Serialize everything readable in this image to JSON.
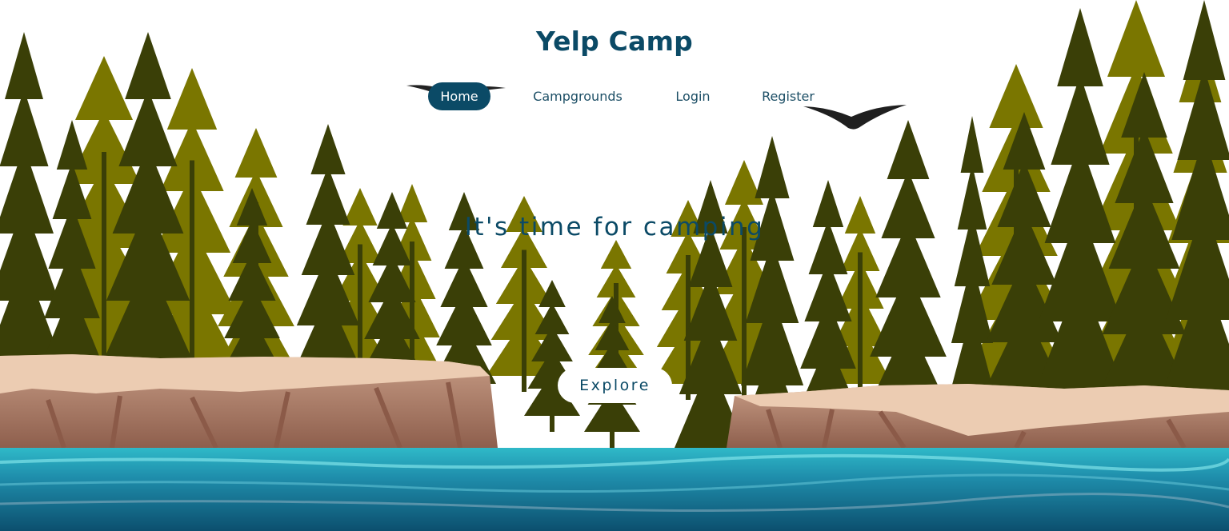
{
  "header": {
    "brand": "Yelp Camp"
  },
  "nav": {
    "items": [
      {
        "label": "Home",
        "active": true
      },
      {
        "label": "Campgrounds",
        "active": false
      },
      {
        "label": "Login",
        "active": false
      },
      {
        "label": "Register",
        "active": false
      }
    ]
  },
  "hero": {
    "title": "It's time for camping",
    "subtitle": "",
    "cta_label": "Explore"
  },
  "colors": {
    "brand": "#0b4a66",
    "foliage_light": "#7a7600",
    "foliage_dark": "#3a3f07",
    "rock": "#c69a82",
    "rock_highlight": "#eccdb0",
    "water": "#1f7c9e",
    "water_light": "#35c9d0"
  },
  "decorations": {
    "icons": [
      "pine-tree-icon",
      "eagle-icon",
      "cliff-rock-icon",
      "river-water-icon"
    ]
  }
}
